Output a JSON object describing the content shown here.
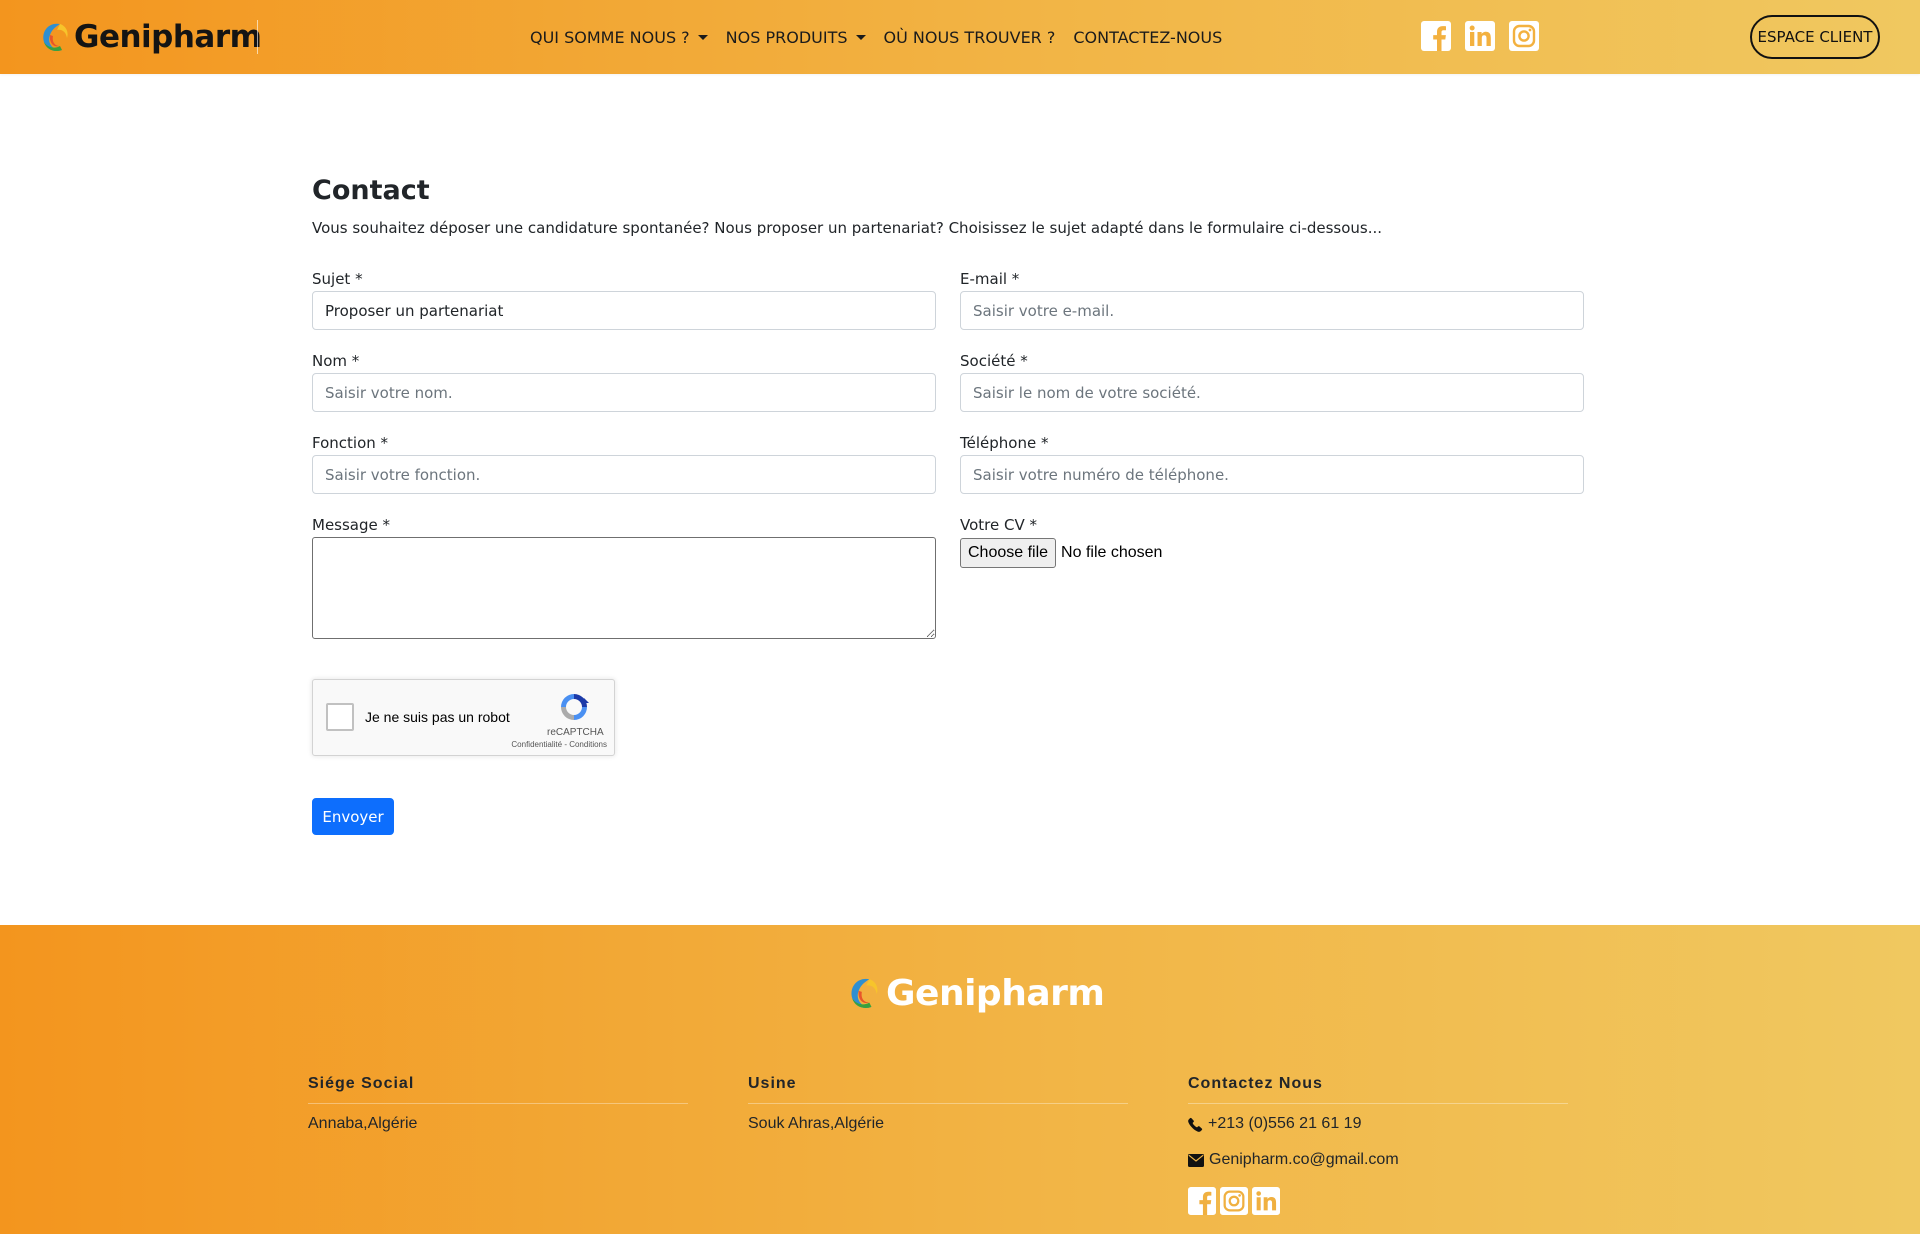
{
  "header": {
    "logo_text": "Genipharm",
    "nav": [
      {
        "label": "QUI SOMME NOUS ?",
        "dropdown": true
      },
      {
        "label": "NOS PRODUITS",
        "dropdown": true
      },
      {
        "label": "OÙ NOUS TROUVER ?",
        "dropdown": false
      },
      {
        "label": "CONTACTEZ-NOUS",
        "dropdown": false
      }
    ],
    "social_icons": [
      "facebook-icon",
      "linkedin-icon",
      "instagram-icon"
    ],
    "espace_client_label": "ESPACE CLIENT"
  },
  "contact": {
    "title": "Contact",
    "subtitle": "Vous souhaitez déposer une candidature spontanée? Nous proposer un partenariat? Choisissez le sujet adapté dans le formulaire ci-dessous...",
    "fields": {
      "sujet": {
        "label": "Sujet *",
        "value": "Proposer un partenariat"
      },
      "email": {
        "label": "E-mail *",
        "placeholder": "Saisir votre e-mail."
      },
      "nom": {
        "label": "Nom *",
        "placeholder": "Saisir votre nom."
      },
      "societe": {
        "label": "Société *",
        "placeholder": "Saisir le nom de votre société."
      },
      "fonction": {
        "label": "Fonction *",
        "placeholder": "Saisir votre fonction."
      },
      "telephone": {
        "label": "Téléphone *",
        "placeholder": "Saisir votre numéro de téléphone."
      },
      "message": {
        "label": "Message *",
        "value": ""
      },
      "cv": {
        "label": "Votre CV *",
        "button_label": "Choose file",
        "status": "No file chosen"
      }
    },
    "recaptcha": {
      "label": "Je ne suis pas un robot",
      "brand": "reCAPTCHA",
      "terms": "Confidentialité - Conditions"
    },
    "submit_label": "Envoyer"
  },
  "footer": {
    "logo_text": "Genipharm",
    "columns": [
      {
        "heading": "Siége Social",
        "text": "Annaba,Algérie"
      },
      {
        "heading": "Usine",
        "text": "Souk Ahras,Algérie"
      },
      {
        "heading": "Contactez Nous",
        "phone": "+213 (0)556 21 61 19",
        "email": "Genipharm.co@gmail.com"
      }
    ],
    "social_icons": [
      "facebook-icon",
      "instagram-icon",
      "linkedin-icon"
    ]
  },
  "colors": {
    "header_gradient_start": "#f3951e",
    "header_gradient_end": "#f0c860",
    "primary_button": "#0d6efd"
  }
}
